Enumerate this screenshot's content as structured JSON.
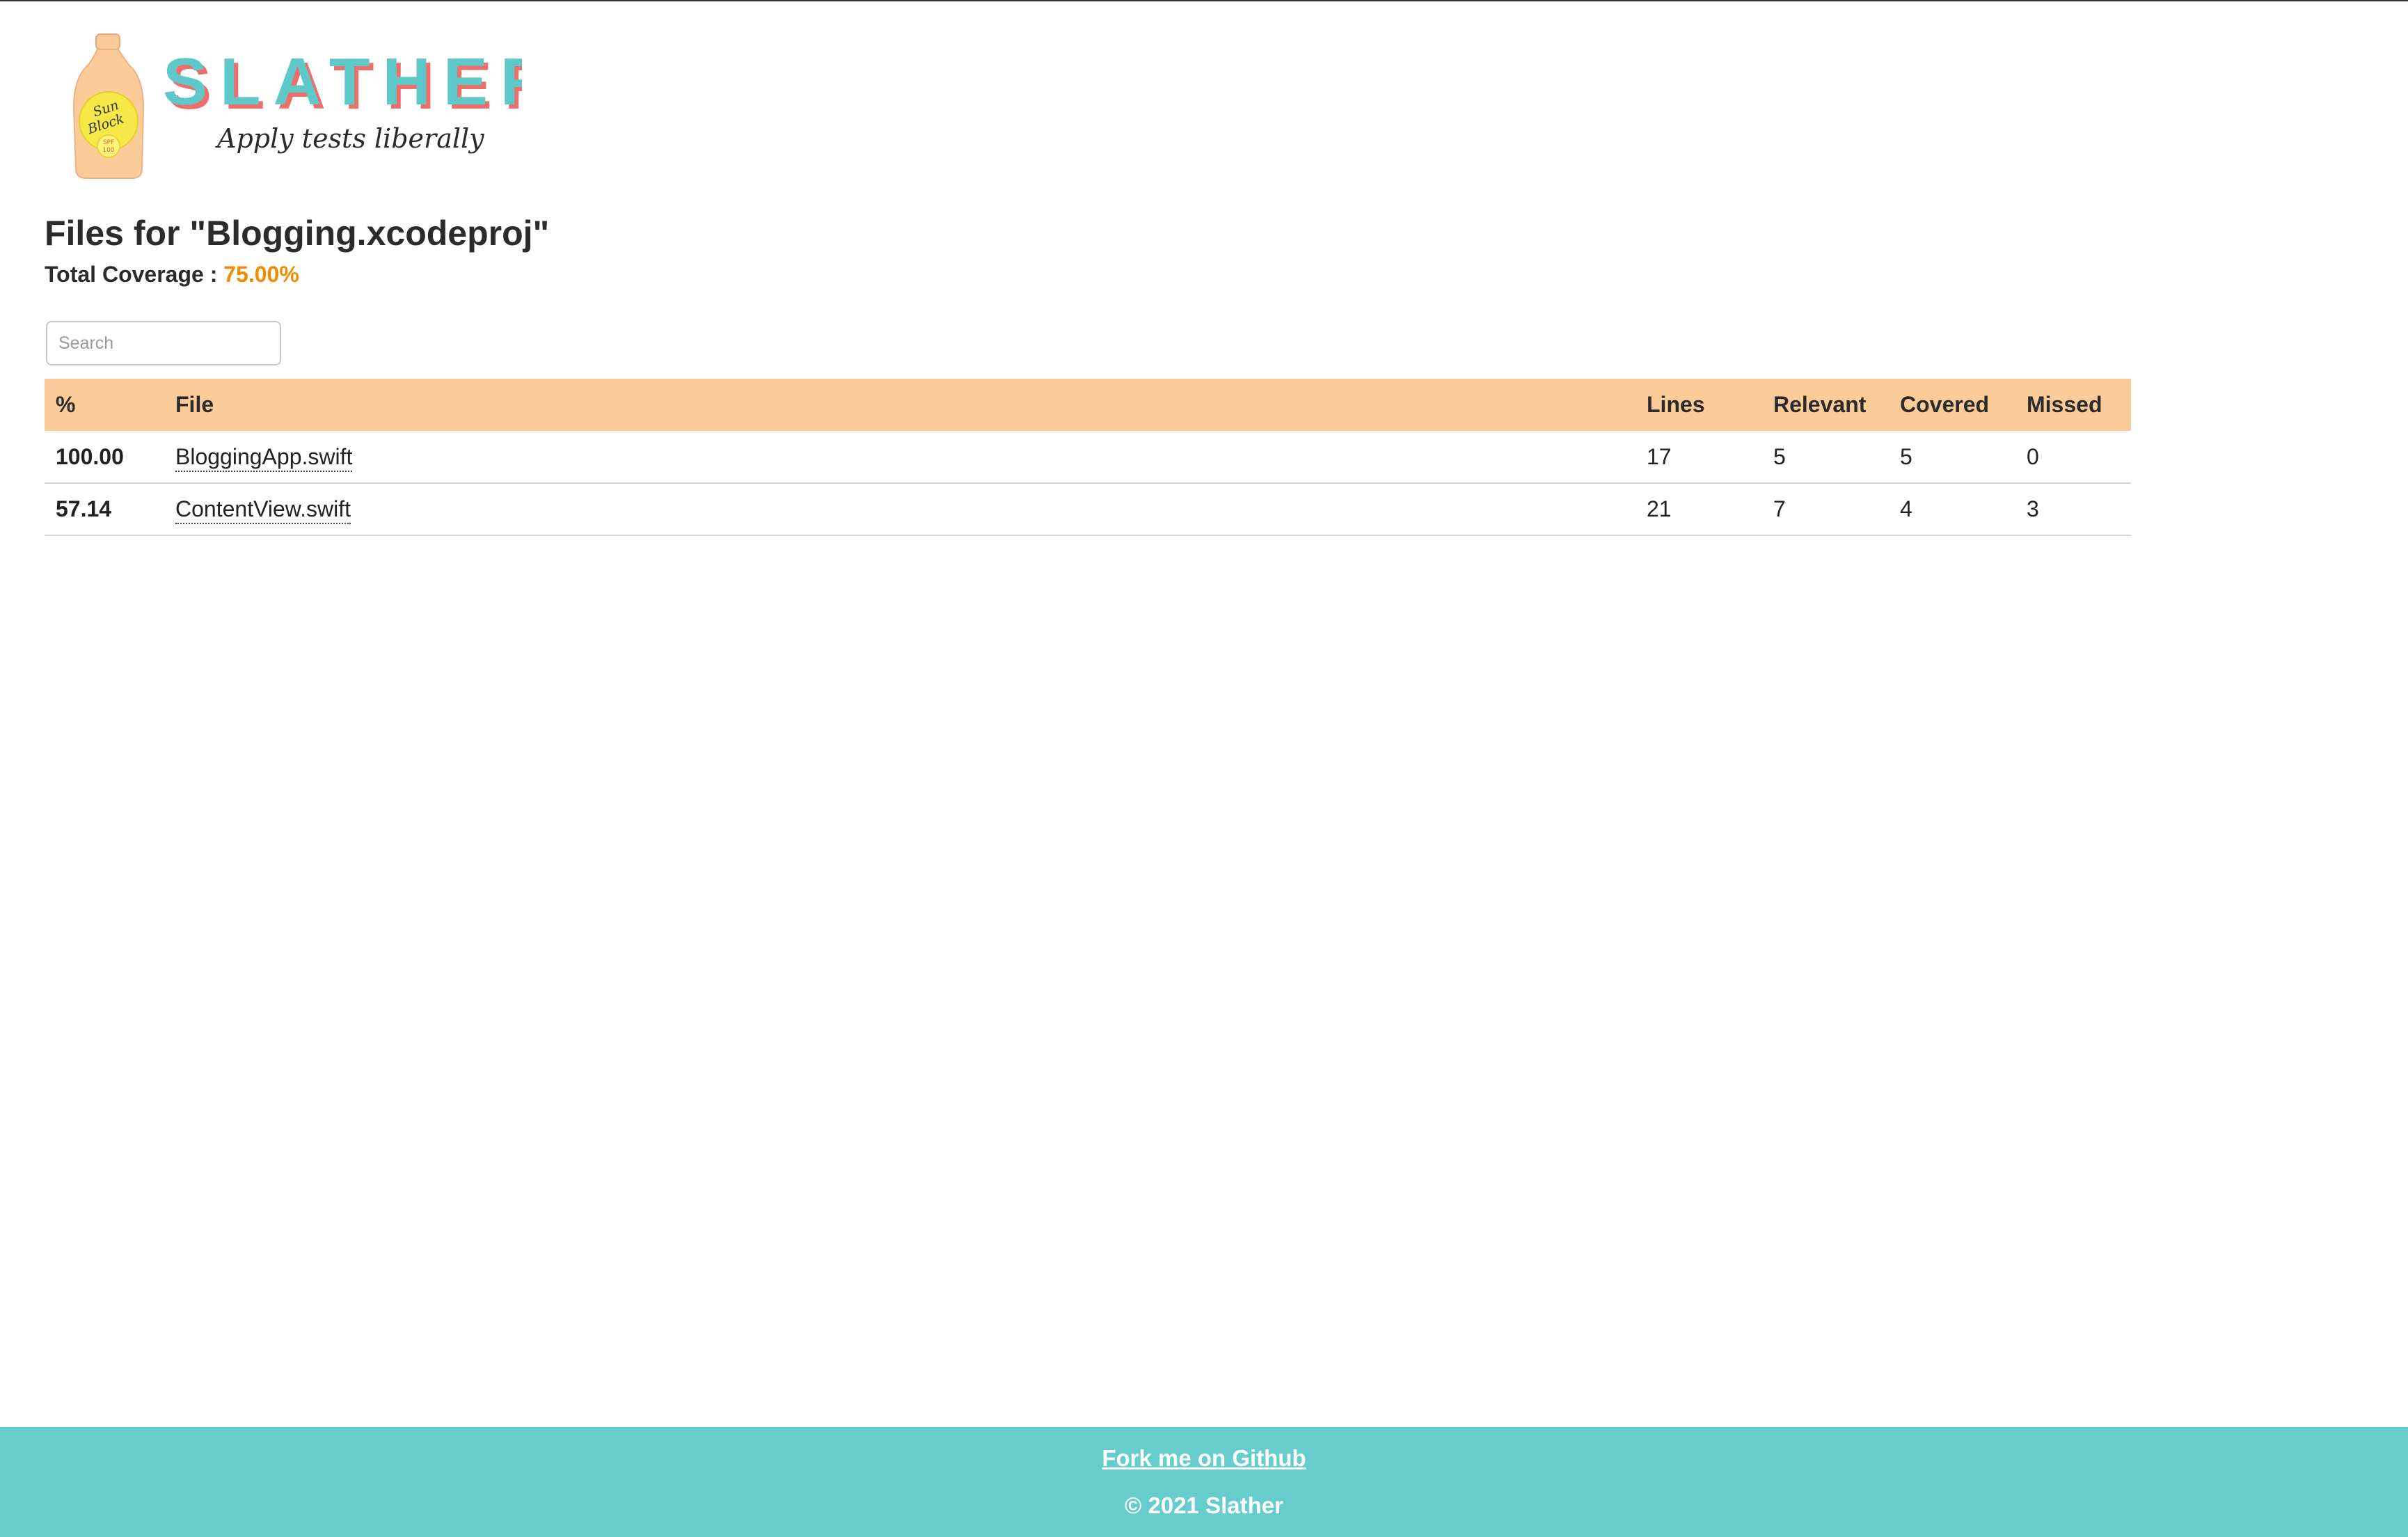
{
  "logo": {
    "brand": "SLATHER",
    "tagline": "Apply tests liberally",
    "bottle_label_top": "Sun",
    "bottle_label_bottom": "Block",
    "bottle_spf": "SPF",
    "bottle_spf_value": "100"
  },
  "header": {
    "title": "Files for \"Blogging.xcodeproj\"",
    "coverage_label": "Total Coverage :",
    "coverage_value": "75.00%"
  },
  "search": {
    "placeholder": "Search",
    "value": ""
  },
  "table": {
    "headers": {
      "pct": "%",
      "file": "File",
      "lines": "Lines",
      "relevant": "Relevant",
      "covered": "Covered",
      "missed": "Missed"
    },
    "rows": [
      {
        "pct": "100.00",
        "file": "BloggingApp.swift",
        "lines": "17",
        "relevant": "5",
        "covered": "5",
        "missed": "0",
        "status": "good"
      },
      {
        "pct": "57.14",
        "file": "ContentView.swift",
        "lines": "21",
        "relevant": "7",
        "covered": "4",
        "missed": "3",
        "status": "bad"
      }
    ]
  },
  "footer": {
    "fork_link": "Fork me on Github",
    "copyright": "© 2021 Slather"
  },
  "colors": {
    "accent_teal": "#66cdcc",
    "header_orange": "#fccb9a",
    "coverage_orange": "#f08c00",
    "good_green": "#58c468",
    "bad_red": "#ee5f5b"
  }
}
